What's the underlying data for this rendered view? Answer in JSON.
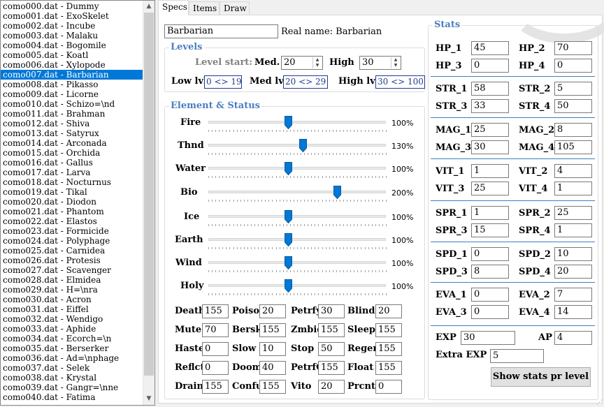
{
  "list": {
    "selected_index": 7,
    "items": [
      "como000.dat - Dummy",
      "como001.dat - ExoSkelet",
      "como002.dat - Incube",
      "como003.dat - Malaku",
      "como004.dat - Bogomile",
      "como005.dat - Koatl",
      "como006.dat - Xylopode",
      "como007.dat - Barbarian",
      "como008.dat - Pikasso",
      "como009.dat - Licorne",
      "como010.dat - Schizo=\\nd",
      "como011.dat - Brahman",
      "como012.dat - Shiva",
      "como013.dat - Satyrux",
      "como014.dat - Arconada",
      "como015.dat - Orchida",
      "como016.dat - Gallus",
      "como017.dat - Larva",
      "como018.dat - Nocturnus",
      "como019.dat - Tikal",
      "como020.dat - Diodon",
      "como021.dat - Phantom",
      "como022.dat - Elastos",
      "como023.dat - Formicide",
      "como024.dat - Polyphage",
      "como025.dat - Carnidea",
      "como026.dat - Protesis",
      "como027.dat - Scavenger",
      "como028.dat - Elmidea",
      "como029.dat - H=\\nra",
      "como030.dat - Acron",
      "como031.dat - Eiffel",
      "como032.dat - Wendigo",
      "como033.dat - Aphide",
      "como034.dat - Ecorch=\\n",
      "como035.dat - Berserker",
      "como036.dat - Ad=\\nphage",
      "como037.dat - Selek",
      "como038.dat - Krystal",
      "como039.dat - Gangr=\\nne",
      "como040.dat - Fatima"
    ]
  },
  "tabs": [
    "Specs",
    "Items",
    "Draw"
  ],
  "specs": {
    "name_value": "Barbarian",
    "real_name": "Real name: Barbarian",
    "levels": {
      "legend": "Levels",
      "level_start": "Level start:",
      "med_label": "Med.",
      "med_value": "20",
      "high_label": "High",
      "high_value": "30",
      "low_lvl_label": "Low lvl",
      "low_lvl_value": "0 <> 19",
      "med_lvl_label": "Med lvl",
      "med_lvl_value": "20 <> 29",
      "high_lvl_label": "High lvl",
      "high_lvl_value": "30 <> 100"
    },
    "element": {
      "legend": "Element & Status",
      "sliders": [
        {
          "label": "Fire",
          "value": 100,
          "pct": "100%"
        },
        {
          "label": "Thnd",
          "value": 130,
          "pct": "130%"
        },
        {
          "label": "Water",
          "value": 100,
          "pct": "100%"
        },
        {
          "label": "Bio",
          "value": 200,
          "pct": "200%"
        },
        {
          "label": "Ice",
          "value": 100,
          "pct": "100%"
        },
        {
          "label": "Earth",
          "value": 100,
          "pct": "100%"
        },
        {
          "label": "Wind",
          "value": 100,
          "pct": "100%"
        },
        {
          "label": "Holy",
          "value": 100,
          "pct": "100%"
        }
      ],
      "status": [
        [
          {
            "label": "Death",
            "value": "155"
          },
          {
            "label": "Poison",
            "value": "20"
          },
          {
            "label": "Petrfy",
            "value": "30"
          },
          {
            "label": "Blind",
            "value": "20"
          }
        ],
        [
          {
            "label": "Mute",
            "value": "70"
          },
          {
            "label": "Bersk",
            "value": "155"
          },
          {
            "label": "Zmbie",
            "value": "155"
          },
          {
            "label": "Sleep",
            "value": "155"
          }
        ],
        [
          {
            "label": "Haste",
            "value": "0"
          },
          {
            "label": "Slow",
            "value": "10"
          },
          {
            "label": "Stop",
            "value": "50"
          },
          {
            "label": "Regen",
            "value": "155"
          }
        ],
        [
          {
            "label": "Reflct",
            "value": "0"
          },
          {
            "label": "Doom",
            "value": "40"
          },
          {
            "label": "PetrfG",
            "value": "155"
          },
          {
            "label": "Float",
            "value": "155"
          }
        ],
        [
          {
            "label": "Drain",
            "value": "155"
          },
          {
            "label": "Confu",
            "value": "155"
          },
          {
            "label": "Vito",
            "value": "20"
          },
          {
            "label": "Prcnt",
            "value": "0"
          }
        ]
      ]
    },
    "stats": {
      "legend": "Stats",
      "groups": [
        [
          {
            "label": "HP_1",
            "value": "45"
          },
          {
            "label": "HP_2",
            "value": "70"
          },
          {
            "label": "HP_3",
            "value": "0"
          },
          {
            "label": "HP_4",
            "value": "0"
          }
        ],
        [
          {
            "label": "STR_1",
            "value": "58"
          },
          {
            "label": "STR_2",
            "value": "5"
          },
          {
            "label": "STR_3",
            "value": "33"
          },
          {
            "label": "STR_4",
            "value": "50"
          }
        ],
        [
          {
            "label": "MAG_1",
            "value": "25"
          },
          {
            "label": "MAG_2",
            "value": "8"
          },
          {
            "label": "MAG_3",
            "value": "30"
          },
          {
            "label": "MAG_4",
            "value": "105"
          }
        ],
        [
          {
            "label": "VIT_1",
            "value": "1"
          },
          {
            "label": "VIT_2",
            "value": "4"
          },
          {
            "label": "VIT_3",
            "value": "25"
          },
          {
            "label": "VIT_4",
            "value": "1"
          }
        ],
        [
          {
            "label": "SPR_1",
            "value": "1"
          },
          {
            "label": "SPR_2",
            "value": "25"
          },
          {
            "label": "SPR_3",
            "value": "15"
          },
          {
            "label": "SPR_4",
            "value": "1"
          }
        ],
        [
          {
            "label": "SPD_1",
            "value": "0"
          },
          {
            "label": "SPD_2",
            "value": "10"
          },
          {
            "label": "SPD_3",
            "value": "8"
          },
          {
            "label": "SPD_4",
            "value": "20"
          }
        ],
        [
          {
            "label": "EVA_1",
            "value": "0"
          },
          {
            "label": "EVA_2",
            "value": "7"
          },
          {
            "label": "EVA_3",
            "value": "0"
          },
          {
            "label": "EVA_4",
            "value": "14"
          }
        ]
      ],
      "exp_label": "EXP",
      "exp_value": "30",
      "ap_label": "AP",
      "ap_value": "4",
      "extra_exp_label": "Extra EXP",
      "extra_exp_value": "5",
      "show_button": "Show stats pr level"
    }
  },
  "colors": {
    "accent": "#4a7fc1",
    "selection": "#0078d7",
    "slider_thumb": "#0078d7",
    "separator": "#3c7fc5"
  }
}
